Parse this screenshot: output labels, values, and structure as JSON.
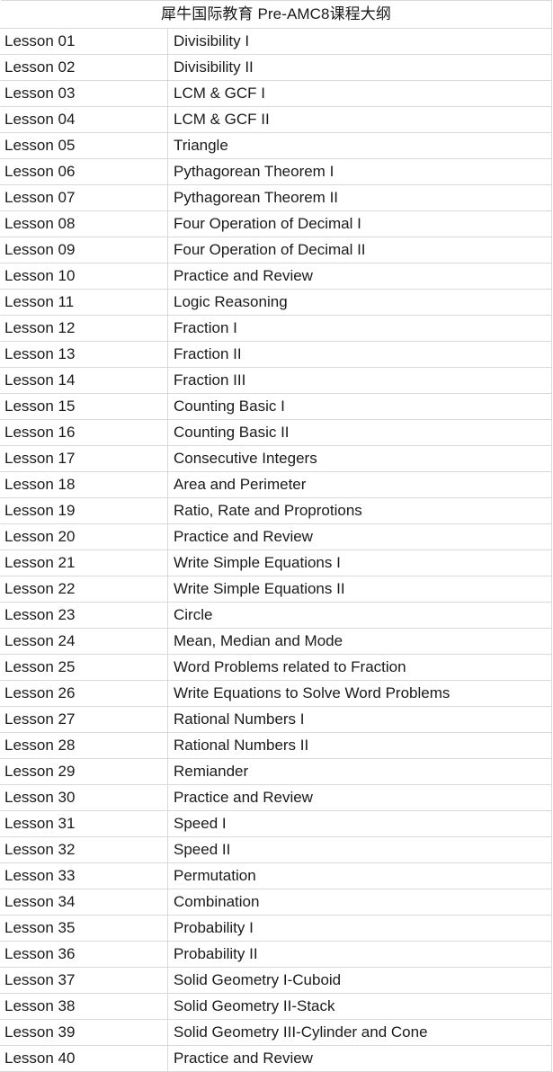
{
  "document": {
    "title": "犀牛国际教育 Pre-AMC8课程大纲",
    "colors": {
      "page_background": "#ffffff",
      "border": "#d9d9d9",
      "text": "#1a1a1a"
    }
  },
  "table": {
    "columns": [
      {
        "key": "lesson",
        "header": ""
      },
      {
        "key": "topic",
        "header": ""
      }
    ],
    "rows": [
      {
        "lesson": "Lesson 01",
        "topic": "Divisibility I"
      },
      {
        "lesson": "Lesson 02",
        "topic": "Divisibility II"
      },
      {
        "lesson": "Lesson 03",
        "topic": "LCM & GCF I"
      },
      {
        "lesson": "Lesson 04",
        "topic": "LCM & GCF II"
      },
      {
        "lesson": "Lesson 05",
        "topic": "Triangle"
      },
      {
        "lesson": "Lesson 06",
        "topic": "Pythagorean Theorem I"
      },
      {
        "lesson": "Lesson 07",
        "topic": "Pythagorean Theorem II"
      },
      {
        "lesson": "Lesson 08",
        "topic": "Four Operation of Decimal I"
      },
      {
        "lesson": "Lesson 09",
        "topic": "Four Operation of Decimal II"
      },
      {
        "lesson": "Lesson 10",
        "topic": "Practice and Review"
      },
      {
        "lesson": "Lesson 11",
        "topic": "Logic Reasoning"
      },
      {
        "lesson": "Lesson 12",
        "topic": "Fraction I"
      },
      {
        "lesson": "Lesson 13",
        "topic": "Fraction II"
      },
      {
        "lesson": "Lesson 14",
        "topic": "Fraction III"
      },
      {
        "lesson": "Lesson 15",
        "topic": "Counting Basic I"
      },
      {
        "lesson": "Lesson 16",
        "topic": "Counting Basic II"
      },
      {
        "lesson": "Lesson 17",
        "topic": "Consecutive Integers"
      },
      {
        "lesson": "Lesson 18",
        "topic": "Area and Perimeter"
      },
      {
        "lesson": "Lesson 19",
        "topic": "Ratio, Rate and Proprotions"
      },
      {
        "lesson": "Lesson 20",
        "topic": "Practice and Review"
      },
      {
        "lesson": "Lesson 21",
        "topic": "Write Simple Equations I"
      },
      {
        "lesson": "Lesson 22",
        "topic": "Write Simple Equations II"
      },
      {
        "lesson": "Lesson 23",
        "topic": "Circle"
      },
      {
        "lesson": "Lesson 24",
        "topic": "Mean, Median and Mode"
      },
      {
        "lesson": "Lesson 25",
        "topic": "Word Problems related to Fraction"
      },
      {
        "lesson": "Lesson 26",
        "topic": "Write Equations to Solve Word Problems"
      },
      {
        "lesson": "Lesson 27",
        "topic": "Rational Numbers I"
      },
      {
        "lesson": "Lesson 28",
        "topic": "Rational Numbers II"
      },
      {
        "lesson": "Lesson 29",
        "topic": "Remiander"
      },
      {
        "lesson": "Lesson 30",
        "topic": "Practice and Review"
      },
      {
        "lesson": "Lesson 31",
        "topic": "Speed I"
      },
      {
        "lesson": "Lesson 32",
        "topic": "Speed II"
      },
      {
        "lesson": "Lesson 33",
        "topic": "Permutation"
      },
      {
        "lesson": "Lesson 34",
        "topic": "Combination"
      },
      {
        "lesson": "Lesson 35",
        "topic": "Probability I"
      },
      {
        "lesson": "Lesson 36",
        "topic": "Probability II"
      },
      {
        "lesson": "Lesson 37",
        "topic": "Solid Geometry I-Cuboid"
      },
      {
        "lesson": "Lesson 38",
        "topic": "Solid Geometry II-Stack"
      },
      {
        "lesson": "Lesson 39",
        "topic": "Solid Geometry III-Cylinder and Cone"
      },
      {
        "lesson": "Lesson 40",
        "topic": "Practice and Review"
      }
    ]
  }
}
